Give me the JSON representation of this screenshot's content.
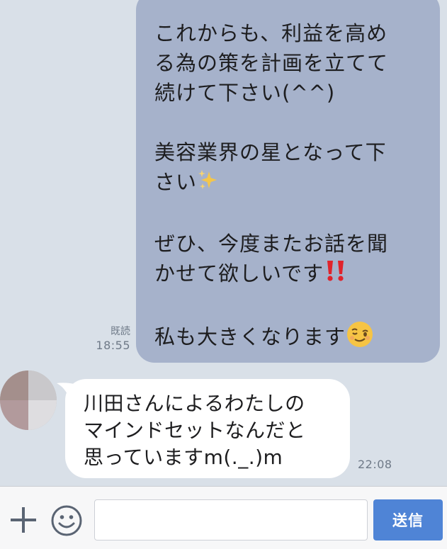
{
  "messages": {
    "outgoing": {
      "paragraphs": [
        "これからも、利益を高め\nる為の策を計画を立てて\n続けて下さい(^^)",
        "美容業界の星となって下\nさい",
        "ぜひ、今度またお話を聞\nかせて欲しいです",
        "私も大きくなります"
      ],
      "emojis": [
        "sparkles-icon",
        "double-exclamation-icon",
        "winking-face-icon"
      ],
      "read_label": "既読",
      "time": "18:55"
    },
    "incoming": {
      "text": "川田さんによるわたしの\nマインドセットなんだと\n思っていますm(._.)m",
      "time": "22:08"
    }
  },
  "input_bar": {
    "placeholder": "",
    "send_label": "送信"
  },
  "colors": {
    "chat_background": "#d9e0e8",
    "outgoing_bubble": "#a6b2cb",
    "incoming_bubble": "#ffffff",
    "send_button": "#4f84d6"
  }
}
